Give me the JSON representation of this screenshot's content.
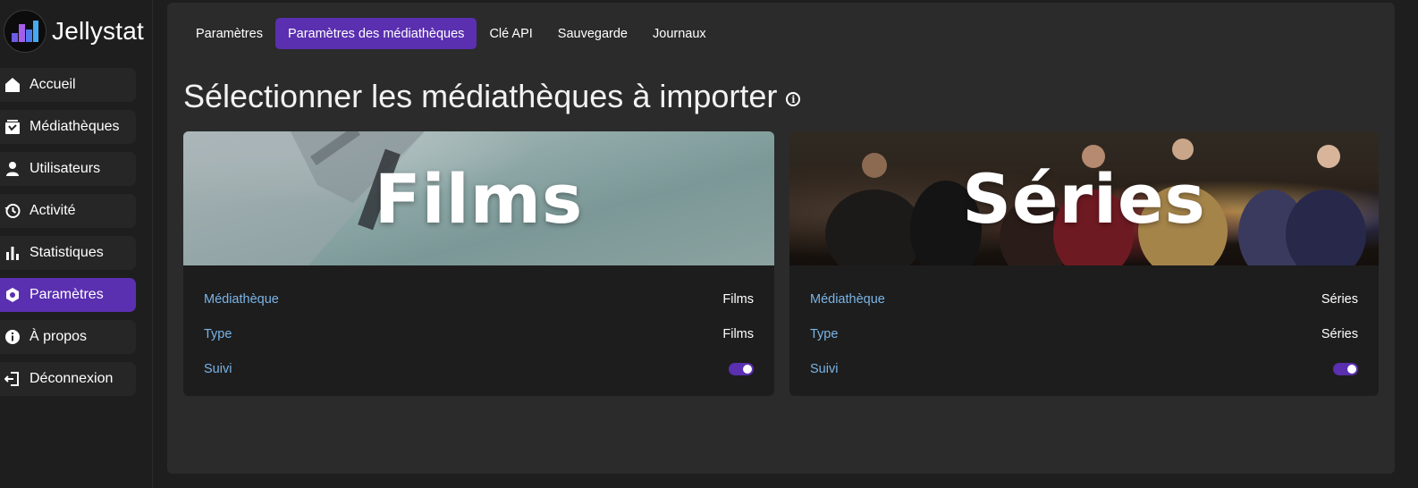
{
  "brand": {
    "name": "Jellystat",
    "icon": "bar-chart-logo-icon"
  },
  "sidebar": {
    "items": [
      {
        "label": "Accueil",
        "icon": "home-icon",
        "active": false
      },
      {
        "label": "Médiathèques",
        "icon": "library-icon",
        "active": false
      },
      {
        "label": "Utilisateurs",
        "icon": "user-icon",
        "active": false
      },
      {
        "label": "Activité",
        "icon": "history-icon",
        "active": false
      },
      {
        "label": "Statistiques",
        "icon": "stats-icon",
        "active": false
      },
      {
        "label": "Paramètres",
        "icon": "settings-hex-icon",
        "active": true
      },
      {
        "label": "À propos",
        "icon": "info-icon",
        "active": false
      },
      {
        "label": "Déconnexion",
        "icon": "logout-icon",
        "active": false
      }
    ]
  },
  "tabs": [
    {
      "label": "Paramètres",
      "active": false
    },
    {
      "label": "Paramètres des médiathèques",
      "active": true
    },
    {
      "label": "Clé API",
      "active": false
    },
    {
      "label": "Sauvegarde",
      "active": false
    },
    {
      "label": "Journaux",
      "active": false
    }
  ],
  "page": {
    "heading": "Sélectionner les médiathèques à importer",
    "info_glyph": "i"
  },
  "libraries": [
    {
      "banner_title": "Films",
      "rows": {
        "library_label": "Médiathèque",
        "library_value": "Films",
        "type_label": "Type",
        "type_value": "Films",
        "tracked_label": "Suivi",
        "tracked": true
      }
    },
    {
      "banner_title": "Séries",
      "rows": {
        "library_label": "Médiathèque",
        "library_value": "Séries",
        "type_label": "Type",
        "type_value": "Séries",
        "tracked_label": "Suivi",
        "tracked": true
      }
    }
  ],
  "colors": {
    "accent": "#5a2fb0",
    "label_blue": "#7ab4e6",
    "panel": "#2b2b2b",
    "background": "#1e1e1e"
  }
}
